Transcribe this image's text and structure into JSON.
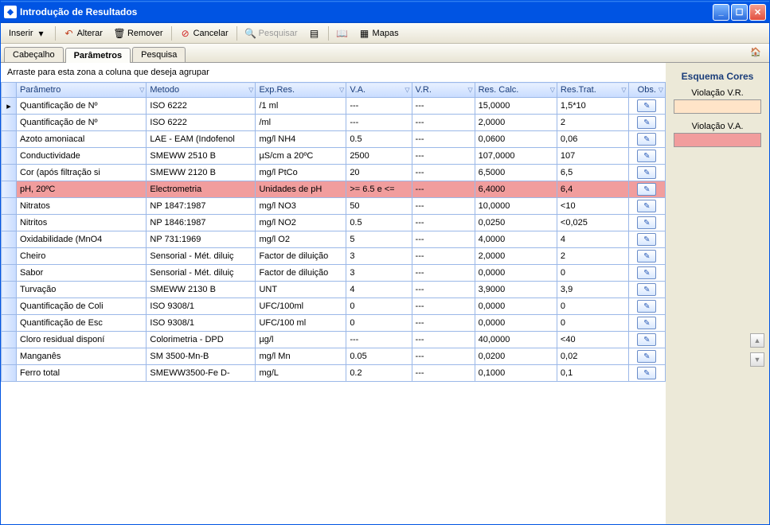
{
  "window": {
    "title": "Introdução de Resultados"
  },
  "toolbar": {
    "inserir": "Inserir",
    "alterar": "Alterar",
    "remover": "Remover",
    "cancelar": "Cancelar",
    "pesquisar": "Pesquisar",
    "mapas": "Mapas"
  },
  "tabs": {
    "cabecalho": "Cabeçalho",
    "parametros": "Parâmetros",
    "pesquisa": "Pesquisa"
  },
  "group_zone": "Arraste para esta zona a coluna que deseja agrupar",
  "columns": {
    "parametro": "Parâmetro",
    "metodo": "Metodo",
    "expres": "Exp.Res.",
    "va": "V.A.",
    "vr": "V.R.",
    "rescalc": "Res. Calc.",
    "restrat": "Res.Trat.",
    "obs": "Obs."
  },
  "legend": {
    "title": "Esquema Cores",
    "vr": "Violação V.R.",
    "va": "Violação V.A."
  },
  "rows": [
    {
      "p": "Quantificação de Nº",
      "m": "ISO 6222",
      "e": "/1 ml",
      "va": "---",
      "vr": "---",
      "rc": "15,0000",
      "rt": "1,5*10",
      "viol": ""
    },
    {
      "p": "Quantificação de Nº",
      "m": "ISO 6222",
      "e": "/ml",
      "va": "---",
      "vr": "---",
      "rc": "2,0000",
      "rt": "2",
      "viol": ""
    },
    {
      "p": "Azoto amoniacal",
      "m": "LAE - EAM (Indofenol",
      "e": "mg/l NH4",
      "va": "0.5",
      "vr": "---",
      "rc": "0,0600",
      "rt": "0,06",
      "viol": ""
    },
    {
      "p": "Conductividade",
      "m": "SMEWW 2510 B",
      "e": "µS/cm a 20ºC",
      "va": "2500",
      "vr": "---",
      "rc": "107,0000",
      "rt": "107",
      "viol": ""
    },
    {
      "p": "Cor (após filtração si",
      "m": "SMEWW 2120 B",
      "e": "mg/l PtCo",
      "va": "20",
      "vr": "---",
      "rc": "6,5000",
      "rt": "6,5",
      "viol": ""
    },
    {
      "p": "pH, 20ºC",
      "m": "Electrometria",
      "e": "Unidades de pH",
      "va": ">= 6.5 e <=",
      "vr": "---",
      "rc": "6,4000",
      "rt": "6,4",
      "viol": "va"
    },
    {
      "p": "Nitratos",
      "m": "NP 1847:1987",
      "e": "mg/l NO3",
      "va": "50",
      "vr": "---",
      "rc": "10,0000",
      "rt": "<10",
      "viol": ""
    },
    {
      "p": "Nitritos",
      "m": "NP 1846:1987",
      "e": "mg/l NO2",
      "va": "0.5",
      "vr": "---",
      "rc": "0,0250",
      "rt": "<0,025",
      "viol": ""
    },
    {
      "p": "Oxidabilidade (MnO4",
      "m": "NP 731:1969",
      "e": "mg/l O2",
      "va": "5",
      "vr": "---",
      "rc": "4,0000",
      "rt": "4",
      "viol": ""
    },
    {
      "p": "Cheiro",
      "m": "Sensorial - Mét. diluiç",
      "e": "Factor de diluição",
      "va": "3",
      "vr": "---",
      "rc": "2,0000",
      "rt": "2",
      "viol": ""
    },
    {
      "p": "Sabor",
      "m": "Sensorial - Mét. diluiç",
      "e": "Factor de diluição",
      "va": "3",
      "vr": "---",
      "rc": "0,0000",
      "rt": "0",
      "viol": ""
    },
    {
      "p": "Turvação",
      "m": "SMEWW 2130 B",
      "e": "UNT",
      "va": "4",
      "vr": "---",
      "rc": "3,9000",
      "rt": "3,9",
      "viol": ""
    },
    {
      "p": "Quantificação de Coli",
      "m": "ISO 9308/1",
      "e": "UFC/100ml",
      "va": "0",
      "vr": "---",
      "rc": "0,0000",
      "rt": "0",
      "viol": ""
    },
    {
      "p": "Quantificação de Esc",
      "m": "ISO 9308/1",
      "e": "UFC/100 ml",
      "va": "0",
      "vr": "---",
      "rc": "0,0000",
      "rt": "0",
      "viol": ""
    },
    {
      "p": "Cloro residual disponí",
      "m": "Colorimetria - DPD",
      "e": "µg/l",
      "va": "---",
      "vr": "---",
      "rc": "40,0000",
      "rt": "<40",
      "viol": ""
    },
    {
      "p": "Manganês",
      "m": "SM 3500-Mn-B",
      "e": "mg/l Mn",
      "va": "0.05",
      "vr": "---",
      "rc": "0,0200",
      "rt": "0,02",
      "viol": ""
    },
    {
      "p": "Ferro total",
      "m": "SMEWW3500-Fe D-",
      "e": "mg/L",
      "va": "0.2",
      "vr": "---",
      "rc": "0,1000",
      "rt": "0,1",
      "viol": ""
    }
  ]
}
